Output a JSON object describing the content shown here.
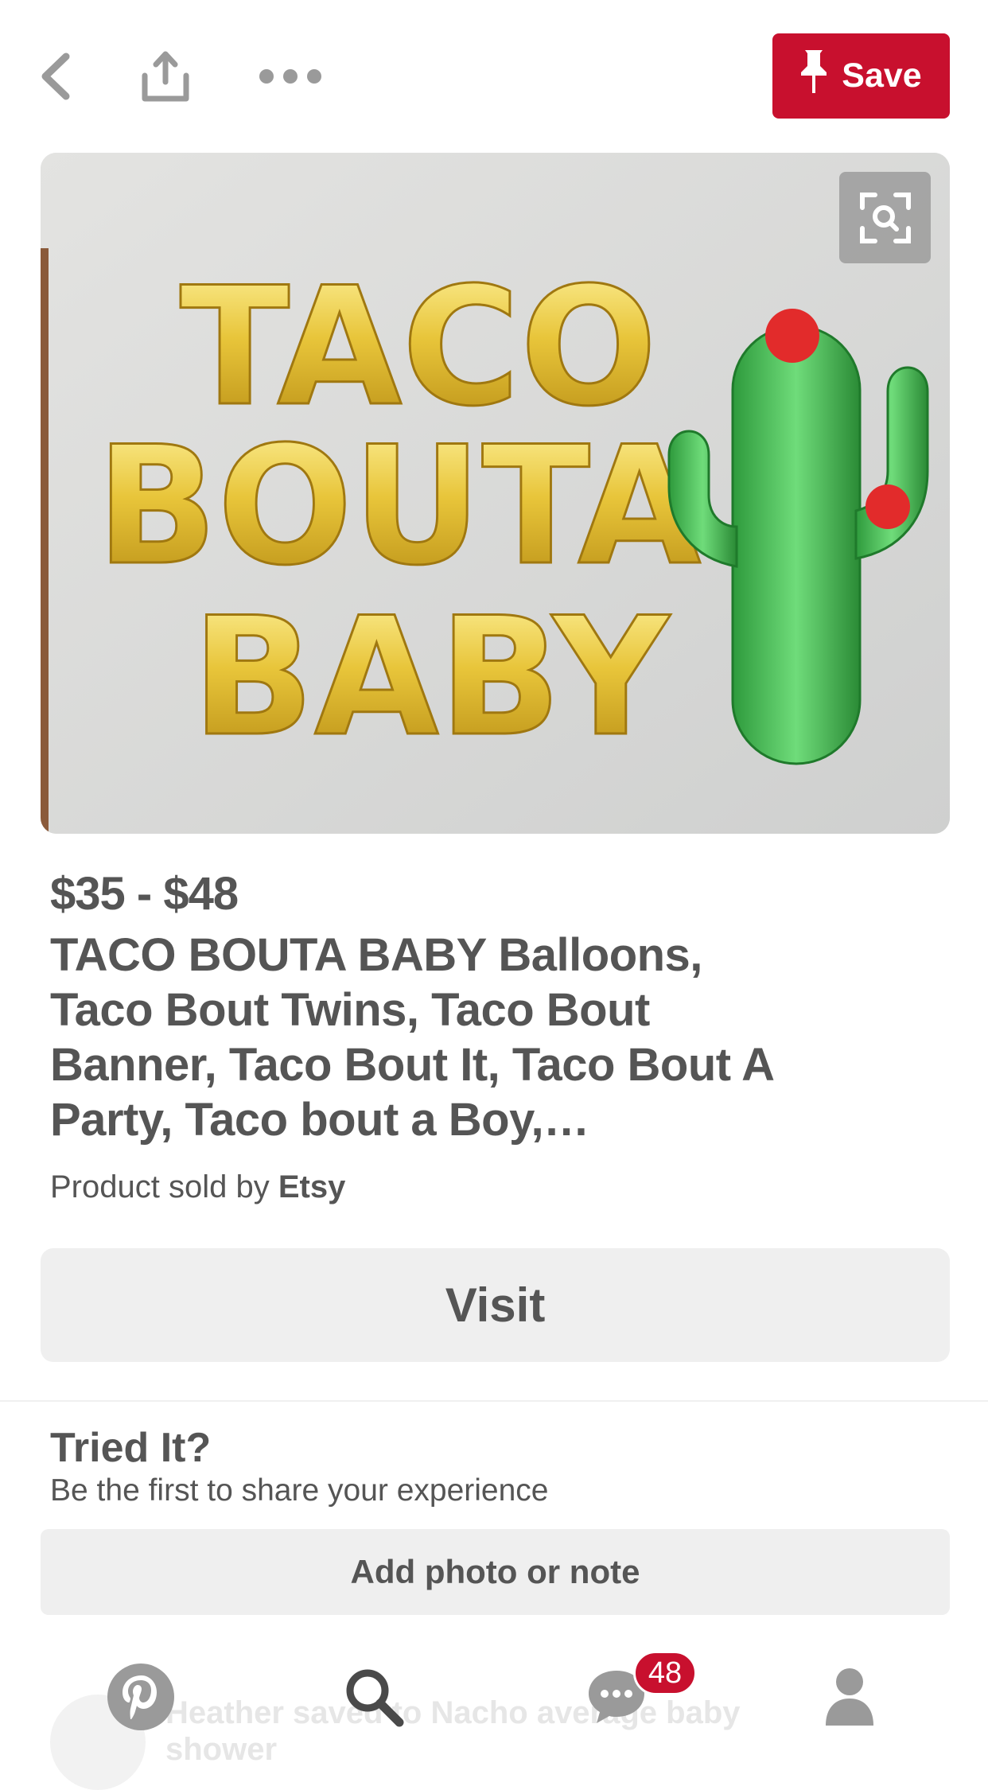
{
  "header": {
    "back_icon": "chevron-left-icon",
    "share_icon": "share-icon",
    "more_icon": "more-dots-icon",
    "save_label": "Save",
    "save_icon": "pin-icon",
    "accent_color": "#c8102e"
  },
  "hero": {
    "lens_icon": "visual-search-icon"
  },
  "product": {
    "price": "$35 - $48",
    "title": "TACO BOUTA BABY Balloons, Taco Bout Twins, Taco Bout Banner, Taco Bout It, Taco Bout A Party, Taco bout a Boy,…",
    "seller_prefix": "Product sold by ",
    "seller_name": "Etsy",
    "visit_label": "Visit"
  },
  "tried_it": {
    "title": "Tried It?",
    "subtitle": "Be the first to share your experience",
    "button_label": "Add photo or note"
  },
  "activity": {
    "text": "Heather saved to Nacho average baby shower"
  },
  "nav": {
    "items": [
      {
        "icon": "pinterest-logo-icon"
      },
      {
        "icon": "search-icon"
      },
      {
        "icon": "messages-icon",
        "badge": "48"
      },
      {
        "icon": "profile-icon"
      }
    ]
  }
}
